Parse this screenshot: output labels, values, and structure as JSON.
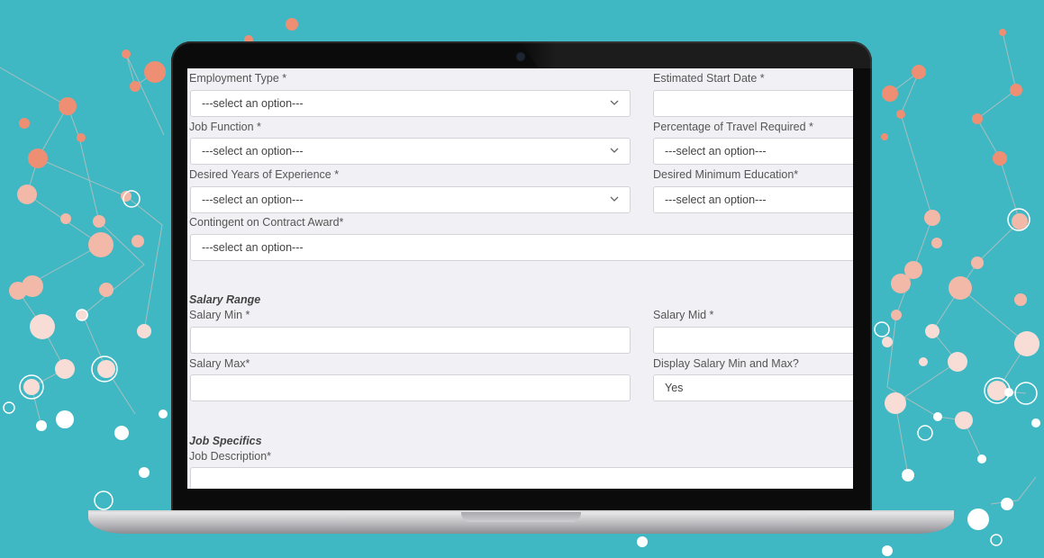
{
  "form": {
    "employment_type_label": "Employment Type *",
    "employment_type_value": "---select an option---",
    "estimated_start_label": "Estimated Start Date *",
    "estimated_start_value": "",
    "job_function_label": "Job Function *",
    "job_function_value": "---select an option---",
    "travel_label": "Percentage of Travel Required *",
    "travel_value": "---select an option---",
    "experience_label": "Desired Years of Experience *",
    "experience_value": "---select an option---",
    "education_label": "Desired Minimum Education*",
    "education_value": "---select an option---",
    "contingent_label": "Contingent on Contract Award*",
    "contingent_value": "---select an option---",
    "salary_section": "Salary Range",
    "salary_min_label": "Salary Min *",
    "salary_min_value": "",
    "salary_mid_label": "Salary Mid *",
    "salary_mid_value": "",
    "salary_max_label": "Salary Max*",
    "salary_max_value": "",
    "display_salary_label": "Display Salary Min and Max?",
    "display_salary_value": "Yes",
    "job_specifics_section": "Job Specifics",
    "job_description_label": "Job Description*",
    "job_description_value": ""
  },
  "icons": {
    "dropdown": "chevron-down-icon",
    "camera": "webcam"
  },
  "colors": {
    "background": "#3fb8c4",
    "nodes_warm": "#ee8f73",
    "nodes_light": "#f6d3cb",
    "screen_bg": "#f1f1f5"
  }
}
